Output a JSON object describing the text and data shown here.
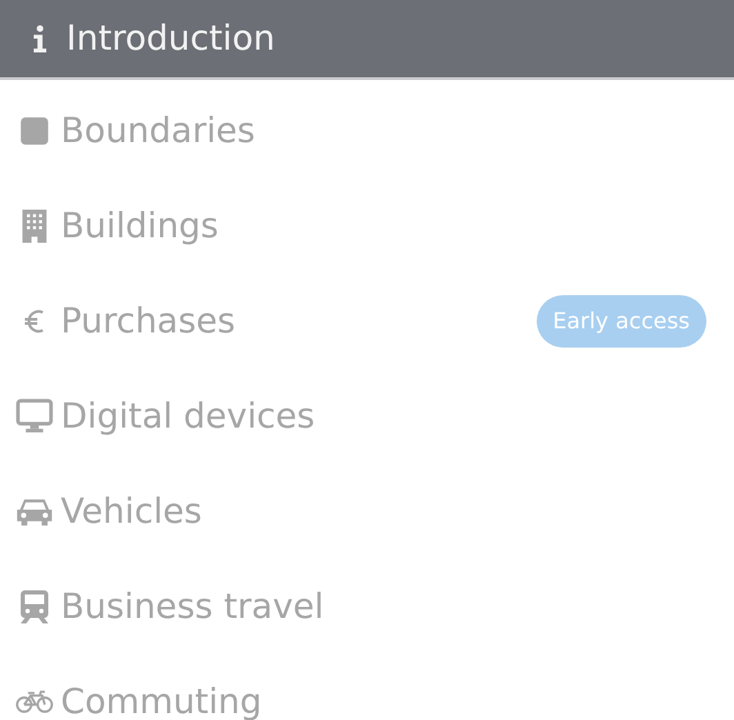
{
  "menu": [
    {
      "kind": "info",
      "label": "Introduction",
      "selected": true
    },
    {
      "kind": "square",
      "label": "Boundaries",
      "selected": false
    },
    {
      "kind": "building",
      "label": "Buildings",
      "selected": false
    },
    {
      "kind": "euro",
      "label": "Purchases",
      "selected": false,
      "badge": "Early access"
    },
    {
      "kind": "monitor",
      "label": "Digital devices",
      "selected": false
    },
    {
      "kind": "car",
      "label": "Vehicles",
      "selected": false
    },
    {
      "kind": "train",
      "label": "Business travel",
      "selected": false
    },
    {
      "kind": "bicycle",
      "label": "Commuting",
      "selected": false
    }
  ]
}
